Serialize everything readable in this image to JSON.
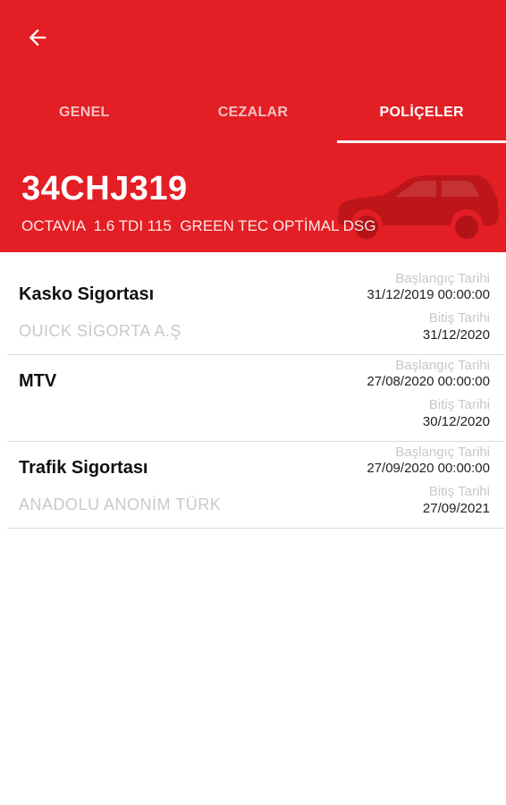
{
  "header": {
    "tabs": [
      {
        "label": "GENEL"
      },
      {
        "label": "CEZALAR"
      },
      {
        "label": "POLİÇELER"
      }
    ],
    "active_tab": 2,
    "plate": "34CHJ319",
    "model": "OCTAVIA  1.6 TDI 115  GREEN TEC OPTİMAL DSG",
    "accent_color": "#e31e24"
  },
  "policies": [
    {
      "name": "Kasko Sigortası",
      "company": "OUICK SİGORTA A.Ş",
      "start_label": "Başlangıç Tarihi",
      "start_date": "31/12/2019 00:00:00",
      "end_label": "Bitiş Tarihi",
      "end_date": "31/12/2020"
    },
    {
      "name": "MTV",
      "company": "",
      "start_label": "Başlangıç Tarihi",
      "start_date": "27/08/2020 00:00:00",
      "end_label": "Bitiş Tarihi",
      "end_date": "30/12/2020"
    },
    {
      "name": "Trafik Sigortası",
      "company": "ANADOLU ANONİM TÜRK",
      "start_label": "Başlangıç Tarihi",
      "start_date": "27/09/2020 00:00:00",
      "end_label": "Bitiş Tarihi",
      "end_date": "27/09/2021"
    }
  ],
  "icons": {
    "back": "arrow-left-icon",
    "vehicle": "car-icon"
  }
}
